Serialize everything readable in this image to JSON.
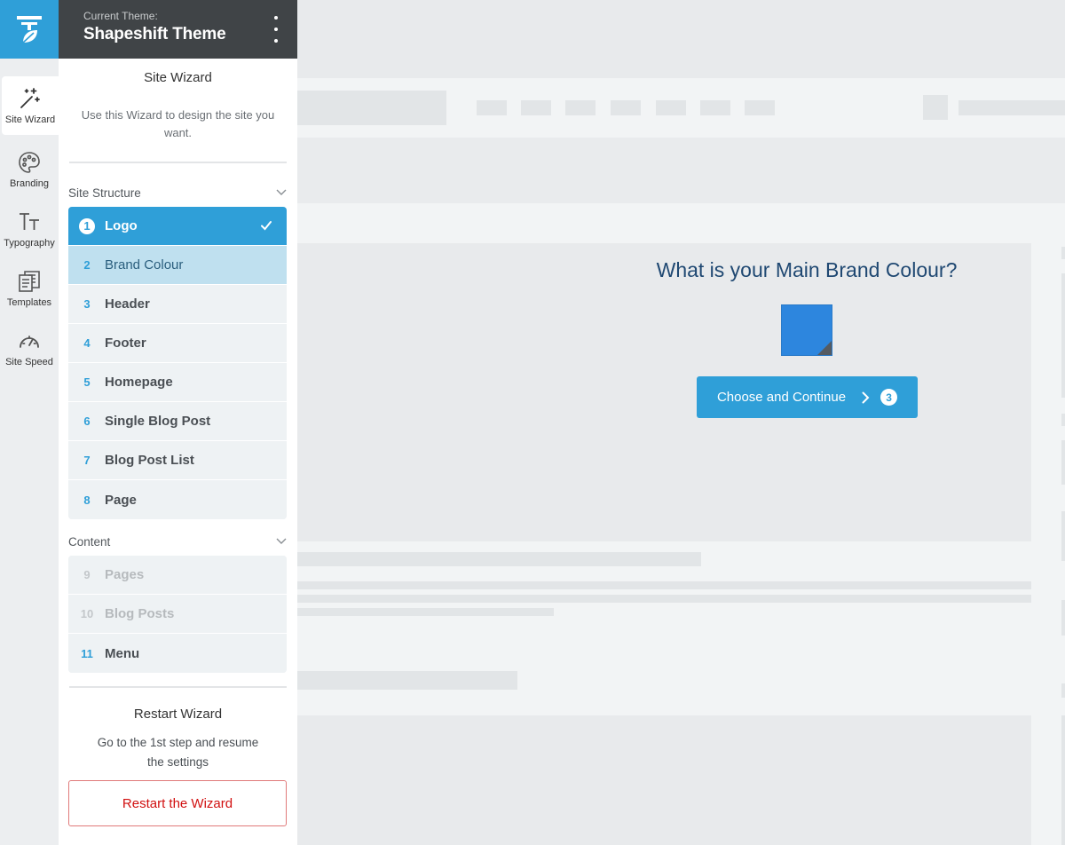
{
  "header": {
    "current_theme_label": "Current Theme:",
    "theme_name": "Shapeshift Theme"
  },
  "rail": {
    "items": [
      {
        "label": "Site Wizard",
        "icon": "magic-wand-icon",
        "active": true
      },
      {
        "label": "Branding",
        "icon": "palette-icon"
      },
      {
        "label": "Typography",
        "icon": "typography-icon"
      },
      {
        "label": "Templates",
        "icon": "templates-icon"
      },
      {
        "label": "Site Speed",
        "icon": "speedometer-icon"
      }
    ]
  },
  "panel": {
    "title": "Site Wizard",
    "description": "Use this Wizard to design the site you want.",
    "sections": [
      {
        "name": "Site Structure",
        "steps": [
          {
            "num": "1",
            "name": "Logo",
            "state": "done"
          },
          {
            "num": "2",
            "name": "Brand Colour",
            "state": "current"
          },
          {
            "num": "3",
            "name": "Header"
          },
          {
            "num": "4",
            "name": "Footer"
          },
          {
            "num": "5",
            "name": "Homepage"
          },
          {
            "num": "6",
            "name": "Single Blog Post"
          },
          {
            "num": "7",
            "name": "Blog Post List"
          },
          {
            "num": "8",
            "name": "Page"
          }
        ]
      },
      {
        "name": "Content",
        "steps": [
          {
            "num": "9",
            "name": "Pages",
            "state": "disabled"
          },
          {
            "num": "10",
            "name": "Blog Posts",
            "state": "disabled"
          },
          {
            "num": "11",
            "name": "Menu"
          }
        ]
      }
    ],
    "restart": {
      "title": "Restart Wizard",
      "description": "Go to the 1st step and resume the settings",
      "button_label": "Restart the Wizard"
    }
  },
  "preview": {
    "question": "What is your Main Brand Colour?",
    "swatch_color": "#2d86de",
    "continue_label": "Choose and Continue",
    "next_step_number": "3"
  },
  "colors": {
    "accent": "#2f9fd8",
    "header_dark": "#404447",
    "danger": "#d10f0f"
  }
}
